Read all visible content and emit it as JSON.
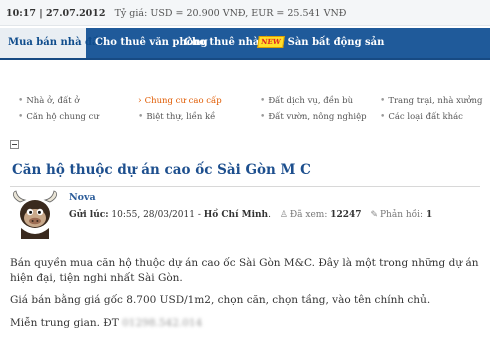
{
  "topbar": {
    "datetime": "10:17 | 27.07.2012",
    "rate_label": "Tỷ giá:",
    "rate_value": "USD = 20.900 VNĐ, EUR = 25.541 VNĐ"
  },
  "nav": {
    "items": [
      {
        "label": "Mua bán nhà đất"
      },
      {
        "label": "Cho thuê văn phòng"
      },
      {
        "label": "Cho thuê nhà ở"
      },
      {
        "label": "Sàn bất động sản",
        "badge": "NEW"
      }
    ]
  },
  "submenu": {
    "items": [
      {
        "label": "Nhà ở, đất ở"
      },
      {
        "label": "Căn hộ chung cư"
      },
      {
        "label": "Chung cư cao cấp"
      },
      {
        "label": "Biệt thự, liền kề"
      },
      {
        "label": "Đất dịch vụ, đền bù"
      },
      {
        "label": "Đất vườn, nông nghiệp"
      },
      {
        "label": "Trang trại, nhà xưởng"
      },
      {
        "label": "Các loại đất khác"
      }
    ]
  },
  "post": {
    "title": "Căn hộ thuộc dự án cao ốc Sài Gòn M C",
    "author": "Nova",
    "sent_label": "Gửi lúc:",
    "sent_time": "10:55, 28/03/2011",
    "location": "Hồ Chí Minh",
    "views_label": "Đã xem:",
    "views": "12247",
    "replies_label": "Phản hồi:",
    "replies": "1",
    "paragraphs": [
      "Bán quyền mua căn hộ thuộc dự án cao ốc Sài Gòn M&C. Đây là một trong những dự án hiện đại, tiện nghi nhất  Sài Gòn.",
      "Giá bán bằng giá gốc 8.700 USD/1m2, chọn căn, chọn tầng, vào tên chính chủ.",
      "Miễn trung gian. ĐT"
    ],
    "phone": "01298.542.014"
  },
  "colors": {
    "nav_bg": "#1f5a9a",
    "title": "#1d4f8e",
    "submenu_active": "#e05a00"
  }
}
